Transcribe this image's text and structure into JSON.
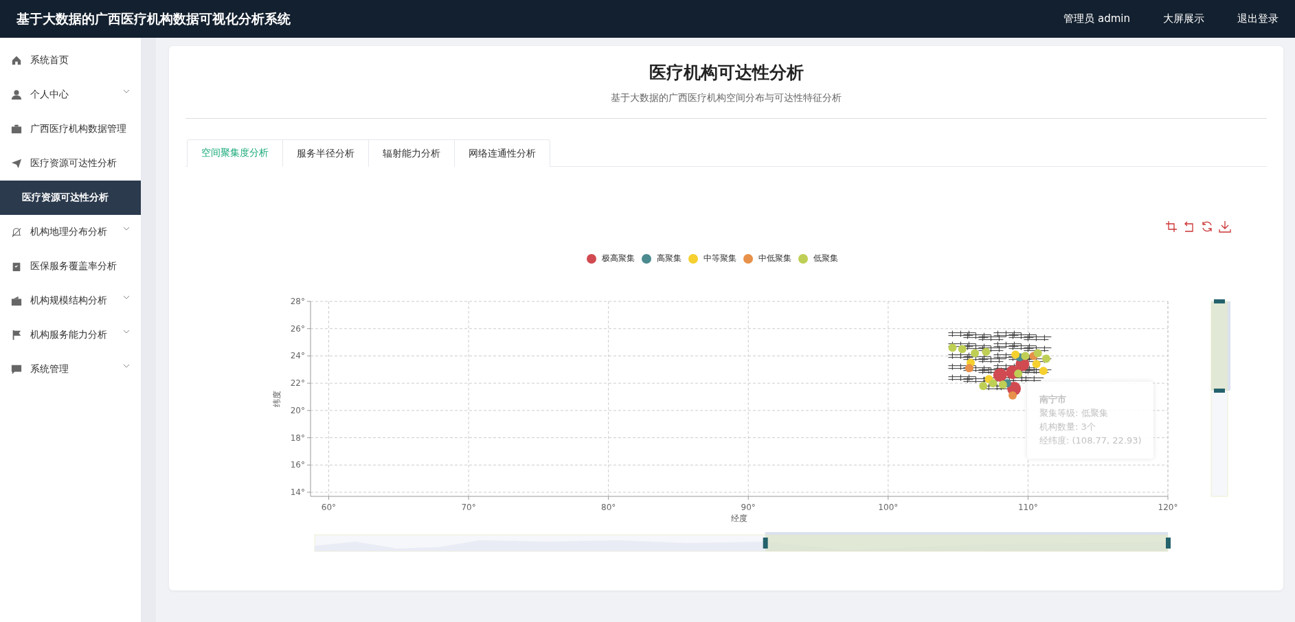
{
  "header": {
    "title": "基于大数据的广西医疗机构数据可视化分析系统",
    "links": [
      "管理员 admin",
      "大屏展示",
      "退出登录"
    ]
  },
  "sidebar": {
    "items": [
      {
        "label": "系统首页",
        "kind": "menu",
        "expandable": false,
        "selected": false
      },
      {
        "label": "个人中心",
        "kind": "menu",
        "expandable": true,
        "selected": false
      },
      {
        "label": "广西医疗机构数据管理",
        "kind": "menu",
        "expandable": false,
        "selected": false
      },
      {
        "label": "医疗资源可达性分析",
        "kind": "menu",
        "expandable": false,
        "selected": false
      },
      {
        "label": "医疗资源可达性分析",
        "kind": "submenu",
        "expandable": false,
        "selected": true
      },
      {
        "label": "机构地理分布分析",
        "kind": "menu",
        "expandable": true,
        "selected": false
      },
      {
        "label": "医保服务覆盖率分析",
        "kind": "menu",
        "expandable": false,
        "selected": false
      },
      {
        "label": "机构规模结构分析",
        "kind": "menu",
        "expandable": true,
        "selected": false
      },
      {
        "label": "机构服务能力分析",
        "kind": "menu",
        "expandable": true,
        "selected": false
      },
      {
        "label": "系统管理",
        "kind": "menu",
        "expandable": true,
        "selected": false
      }
    ]
  },
  "page": {
    "title": "医疗机构可达性分析",
    "subtitle": "基于大数据的广西医疗机构空间分布与可达性特征分析"
  },
  "tabs": [
    {
      "label": "空间聚集度分析",
      "selected": true
    },
    {
      "label": "服务半径分析",
      "selected": false
    },
    {
      "label": "辐射能力分析",
      "selected": false
    },
    {
      "label": "网络连通性分析",
      "selected": false
    }
  ],
  "chart": {
    "tooltip": {
      "title": "南宁市",
      "lines": [
        "聚集等级: 低聚集",
        "机构数量: 3个",
        "经纬度: (108.77, 22.93)"
      ]
    },
    "chart_data": {
      "type": "scatter",
      "xlabel": "经度",
      "ylabel": "纬度",
      "grid": true,
      "xlim": [
        58.7,
        120
      ],
      "ylim": [
        13.7,
        28
      ],
      "xticks": [
        {
          "value": 60,
          "label": "60°"
        },
        {
          "value": 70,
          "label": "70°"
        },
        {
          "value": 80,
          "label": "80°"
        },
        {
          "value": 90,
          "label": "90°"
        },
        {
          "value": 100,
          "label": "100°"
        },
        {
          "value": 110,
          "label": "110°"
        },
        {
          "value": 120,
          "label": "120°"
        }
      ],
      "yticks": [
        {
          "value": 14,
          "label": "14°"
        },
        {
          "value": 16,
          "label": "16°"
        },
        {
          "value": 18,
          "label": "18°"
        },
        {
          "value": 20,
          "label": "20°"
        },
        {
          "value": 22,
          "label": "22°"
        },
        {
          "value": 24,
          "label": "24°"
        },
        {
          "value": 26,
          "label": "26°"
        },
        {
          "value": 28,
          "label": "28°"
        }
      ],
      "series": [
        {
          "name": "极高聚集",
          "color": "#d14a51",
          "x": [
            108.9,
            109.6,
            108.0,
            109.0
          ],
          "values": [
            22.8,
            23.4,
            22.6,
            21.6
          ]
        },
        {
          "name": "高聚集",
          "color": "#4b8a8f",
          "x": [
            109.4,
            108.5
          ],
          "values": [
            23.9,
            22.0
          ]
        },
        {
          "name": "中等聚集",
          "color": "#f5d02f",
          "x": [
            109.1,
            110.6,
            111.1,
            105.9,
            107.2
          ],
          "values": [
            24.1,
            23.4,
            22.9,
            23.5,
            22.3
          ]
        },
        {
          "name": "中低聚集",
          "color": "#e8914a",
          "x": [
            105.8,
            108.9,
            110.4
          ],
          "values": [
            23.1,
            21.1,
            24.0
          ]
        },
        {
          "name": "低聚集",
          "color": "#bfcf55",
          "x": [
            104.6,
            105.3,
            106.2,
            107.0,
            107.5,
            108.2,
            109.8,
            110.7,
            111.3,
            106.8,
            109.3
          ],
          "values": [
            24.6,
            24.5,
            24.2,
            24.3,
            22.0,
            21.9,
            24.0,
            24.2,
            23.8,
            21.8,
            22.7
          ]
        }
      ]
    }
  }
}
